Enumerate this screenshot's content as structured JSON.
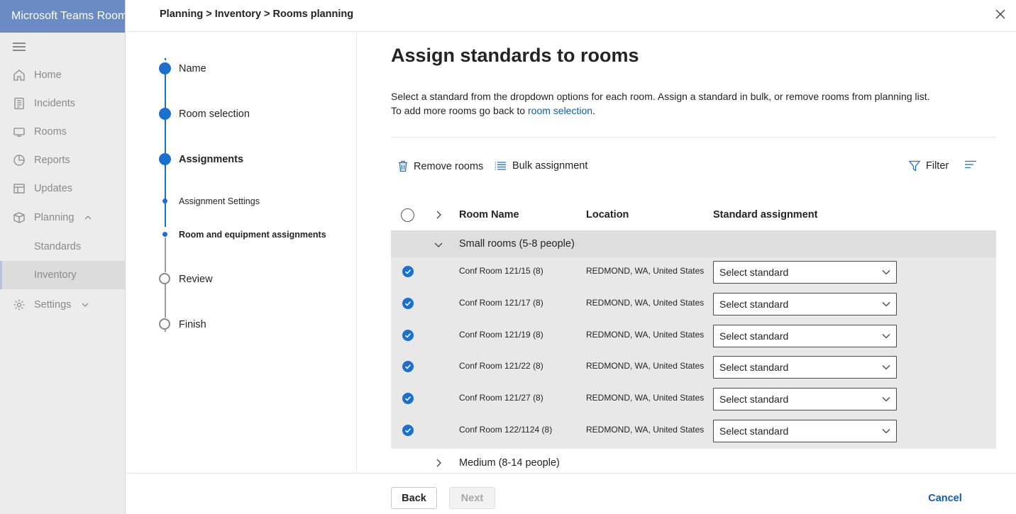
{
  "app": {
    "title": "Microsoft Teams Rooms"
  },
  "nav": {
    "items": [
      {
        "label": "Home",
        "icon": "home-icon"
      },
      {
        "label": "Incidents",
        "icon": "incidents-icon"
      },
      {
        "label": "Rooms",
        "icon": "rooms-icon"
      },
      {
        "label": "Reports",
        "icon": "reports-icon"
      },
      {
        "label": "Updates",
        "icon": "updates-icon"
      },
      {
        "label": "Planning",
        "icon": "planning-icon",
        "expanded": true
      },
      {
        "label": "Standards"
      },
      {
        "label": "Inventory",
        "selected": true
      },
      {
        "label": "Settings",
        "icon": "settings-icon",
        "expanded": false
      }
    ]
  },
  "panel": {
    "breadcrumb": "Planning > Inventory > Rooms planning"
  },
  "steps": {
    "name": "Name",
    "room_selection": "Room selection",
    "assignments": "Assignments",
    "assignment_settings": "Assignment Settings",
    "room_equipment": "Room and equipment assignments",
    "review": "Review",
    "finish": "Finish"
  },
  "content": {
    "title": "Assign standards to rooms",
    "desc_line1": "Select a standard from the dropdown options for each room. Assign a standard in bulk, or remove rooms from planning list.",
    "desc_line2_prefix": "To add more rooms go back to ",
    "desc_link": "room selection",
    "desc_line2_suffix": "."
  },
  "toolbar": {
    "remove_rooms": "Remove rooms",
    "bulk_assignment": "Bulk assignment",
    "filter": "Filter"
  },
  "table": {
    "headers": {
      "room_name": "Room Name",
      "location": "Location",
      "standard": "Standard assignment"
    },
    "groups": [
      {
        "label": "Small rooms (5-8 people)",
        "expanded": true,
        "rooms": [
          {
            "name": "Conf Room 121/15 (8)",
            "location": "REDMOND, WA, United States",
            "standard": "Select standard",
            "checked": true
          },
          {
            "name": "Conf Room 121/17 (8)",
            "location": "REDMOND, WA, United States",
            "standard": "Select standard",
            "checked": true
          },
          {
            "name": "Conf Room 121/19 (8)",
            "location": "REDMOND, WA, United States",
            "standard": "Select standard",
            "checked": true
          },
          {
            "name": "Conf Room 121/22 (8)",
            "location": "REDMOND, WA, United States",
            "standard": "Select standard",
            "checked": true
          },
          {
            "name": "Conf Room 121/27 (8)",
            "location": "REDMOND, WA, United States",
            "standard": "Select standard",
            "checked": true
          },
          {
            "name": "Conf Room 122/1124 (8)",
            "location": "REDMOND, WA, United States",
            "standard": "Select standard",
            "checked": true
          }
        ]
      },
      {
        "label": "Medium (8-14 people)",
        "expanded": false
      }
    ]
  },
  "footer": {
    "back": "Back",
    "next": "Next",
    "cancel": "Cancel"
  },
  "colors": {
    "accent": "#1b6fd1",
    "link": "#0f5cb5",
    "app_header": "#6a8bc4"
  }
}
